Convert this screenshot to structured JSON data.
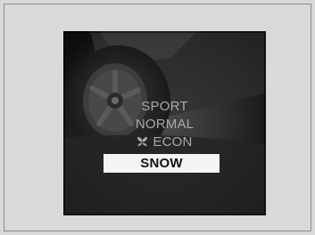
{
  "drive_mode_menu": {
    "items": [
      {
        "label": "SPORT",
        "icon": null,
        "selected": false
      },
      {
        "label": "NORMAL",
        "icon": null,
        "selected": false
      },
      {
        "label": "ECON",
        "icon": "econ-leaf-icon",
        "selected": false
      },
      {
        "label": "SNOW",
        "icon": null,
        "selected": true
      }
    ]
  },
  "colors": {
    "page_background": "#d9d9d9",
    "screen_background": "#1a1a1a",
    "item_text": "#a9a9a9",
    "selected_background": "#f4f4f4",
    "selected_text": "#111111"
  }
}
